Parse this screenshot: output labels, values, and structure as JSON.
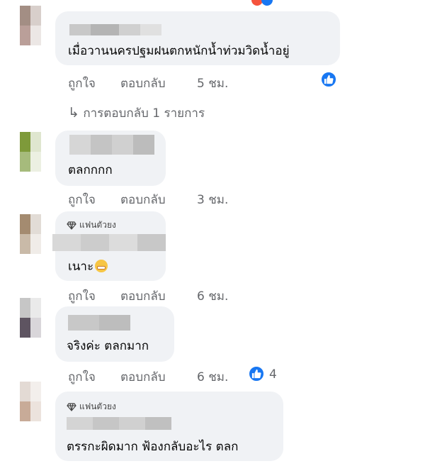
{
  "comments": [
    {
      "text": "เมื่อวานนครปฐมฝนตกหนักน้ำท่วมวิดน้ำอยู่",
      "like_label": "ถูกใจ",
      "reply_label": "ตอบกลับ",
      "time": "5 ชม."
    },
    {
      "text": "ตลกกกก",
      "like_label": "ถูกใจ",
      "reply_label": "ตอบกลับ",
      "time": "3 ชม."
    },
    {
      "badge": "แฟนตัวยง",
      "text": "เนาะ",
      "like_label": "ถูกใจ",
      "reply_label": "ตอบกลับ",
      "time": "6 ชม."
    },
    {
      "text": "จริงค่ะ ตลกมาก",
      "like_label": "ถูกใจ",
      "reply_label": "ตอบกลับ",
      "time": "6 ชม.",
      "like_count": "4"
    },
    {
      "badge": "แฟนตัวยง",
      "text": "ตรรกะผิดมาก ฟ้องกลับอะไร ตลก"
    }
  ],
  "replies_link": "การตอบกลับ 1 รายการ",
  "colors": {
    "bubble": "#f0f2f5",
    "like_blue": "#1877f2",
    "meta_gray": "#65676b"
  },
  "icons": {
    "like": "thumbs-up-icon",
    "fan": "diamond-icon",
    "emoji": "grimacing-face-icon",
    "reply_arrow": "reply-arrow-icon"
  }
}
